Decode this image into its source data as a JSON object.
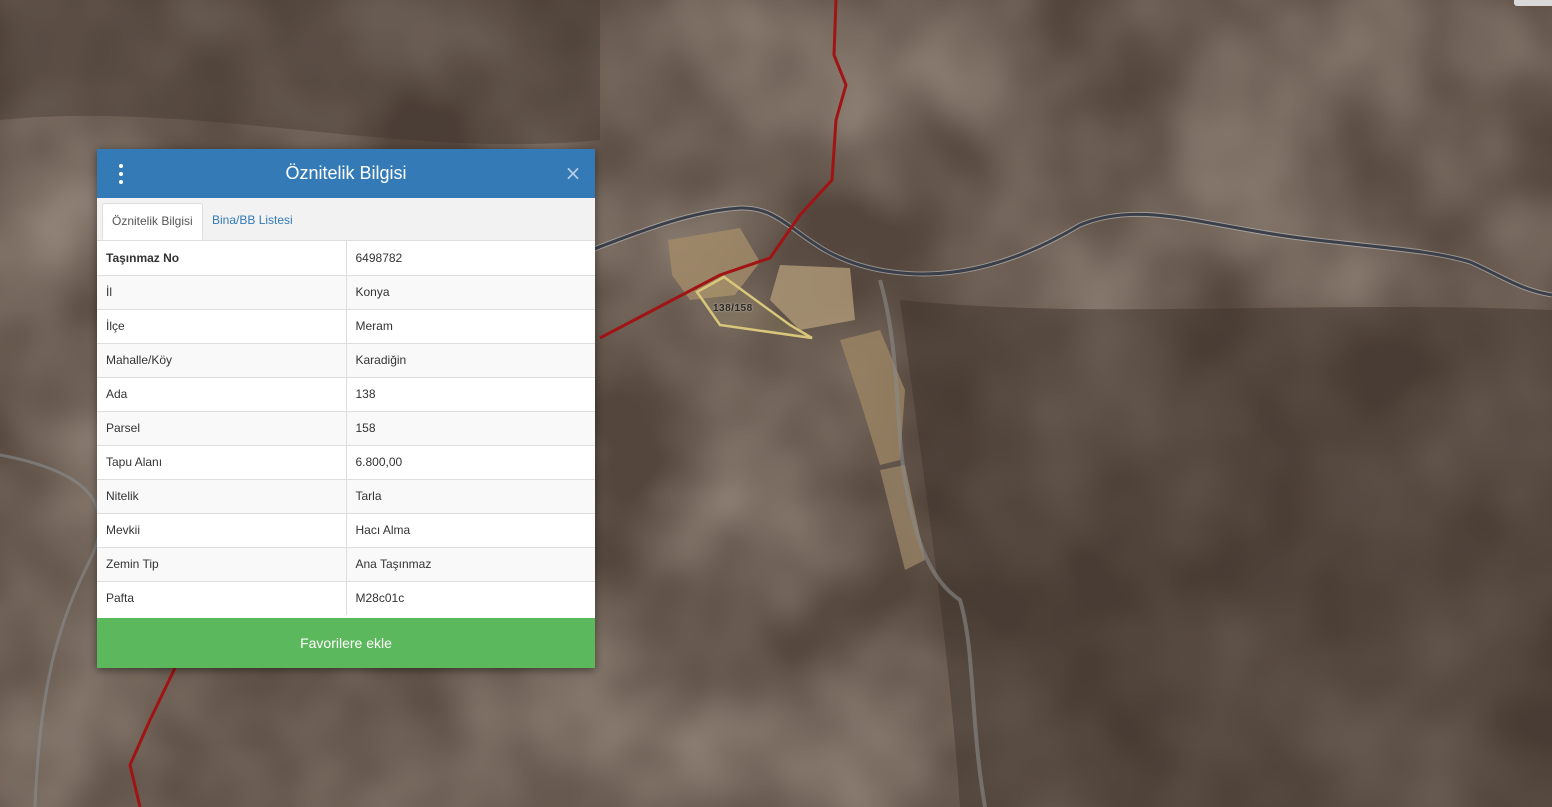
{
  "map": {
    "parcel_label": "138/158",
    "colors": {
      "boundary": "#a01414",
      "road": "#3a3f4a",
      "parcel_outline": "#d8c77a"
    }
  },
  "panel": {
    "title": "Öznitelik Bilgisi",
    "close_glyph": "×",
    "tabs": [
      {
        "label": "Öznitelik Bilgisi",
        "active": true
      },
      {
        "label": "Bina/BB Listesi",
        "active": false
      }
    ],
    "rows": [
      {
        "key": "Taşınmaz No",
        "value": "6498782"
      },
      {
        "key": "İl",
        "value": "Konya"
      },
      {
        "key": "İlçe",
        "value": "Meram"
      },
      {
        "key": "Mahalle/Köy",
        "value": "Karadiğin"
      },
      {
        "key": "Ada",
        "value": "138"
      },
      {
        "key": "Parsel",
        "value": "158"
      },
      {
        "key": "Tapu Alanı",
        "value": "6.800,00"
      },
      {
        "key": "Nitelik",
        "value": "Tarla"
      },
      {
        "key": "Mevkii",
        "value": "Hacı Alma"
      },
      {
        "key": "Zemin Tip",
        "value": "Ana Taşınmaz"
      },
      {
        "key": "Pafta",
        "value": "M28c01c"
      }
    ],
    "favorite_button": "Favorilere ekle",
    "colors": {
      "header": "#337ab7",
      "button": "#5cb85c"
    }
  }
}
